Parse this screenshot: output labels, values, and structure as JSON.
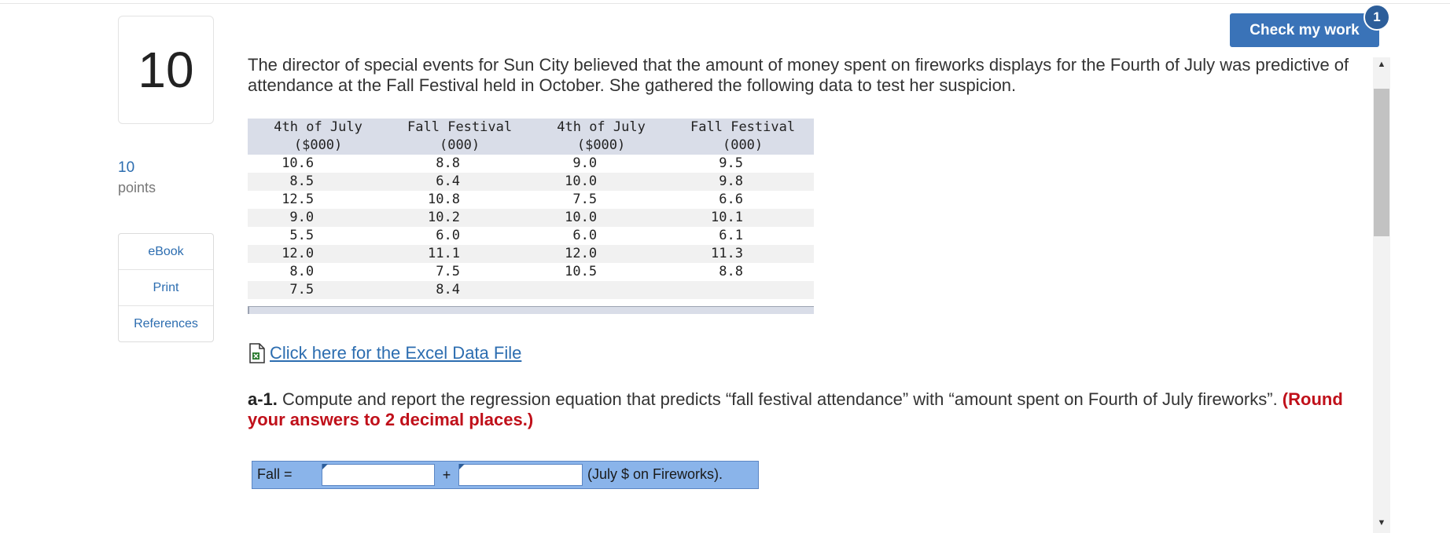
{
  "question": {
    "number": "10",
    "points_value": "10",
    "points_label": "points"
  },
  "side_menu": [
    "eBook",
    "Print",
    "References"
  ],
  "check_button": {
    "label": "Check my work",
    "badge": "1"
  },
  "prompt_text": "The director of special events for Sun City believed that the amount of money spent on fireworks displays for the Fourth of July was predictive of attendance at the Fall Festival held in October. She gathered the following data to test her suspicion.",
  "table": {
    "headers": [
      {
        "line1": "4th of July",
        "line2": "($000)"
      },
      {
        "line1": "Fall Festival",
        "line2": "(000)"
      },
      {
        "line1": "4th of July",
        "line2": "($000)"
      },
      {
        "line1": "Fall Festival",
        "line2": "(000)"
      }
    ],
    "rows": [
      [
        "10.6",
        "8.8",
        "9.0",
        "9.5"
      ],
      [
        "8.5",
        "6.4",
        "10.0",
        "9.8"
      ],
      [
        "12.5",
        "10.8",
        "7.5",
        "6.6"
      ],
      [
        "9.0",
        "10.2",
        "10.0",
        "10.1"
      ],
      [
        "5.5",
        "6.0",
        "6.0",
        "6.1"
      ],
      [
        "12.0",
        "11.1",
        "12.0",
        "11.3"
      ],
      [
        "8.0",
        "7.5",
        "10.5",
        "8.8"
      ],
      [
        "7.5",
        "8.4",
        "",
        ""
      ]
    ]
  },
  "excel_link": " Click here for the Excel Data File",
  "part": {
    "label": "a-1.",
    "text": " Compute and report the regression equation that predicts “fall festival attendance” with “amount spent on Fourth of July fireworks”. ",
    "note": "(Round your answers to 2 decimal places.)"
  },
  "answer": {
    "prefix": "Fall =",
    "operator": "+",
    "suffix": "(July $ on Fireworks).",
    "input1_value": "",
    "input2_value": ""
  },
  "colors": {
    "accent": "#3a73b8",
    "link": "#2c6db0",
    "note_red": "#c0101a",
    "table_header": "#d9dde8",
    "answer_bg": "#8ab4ea"
  }
}
